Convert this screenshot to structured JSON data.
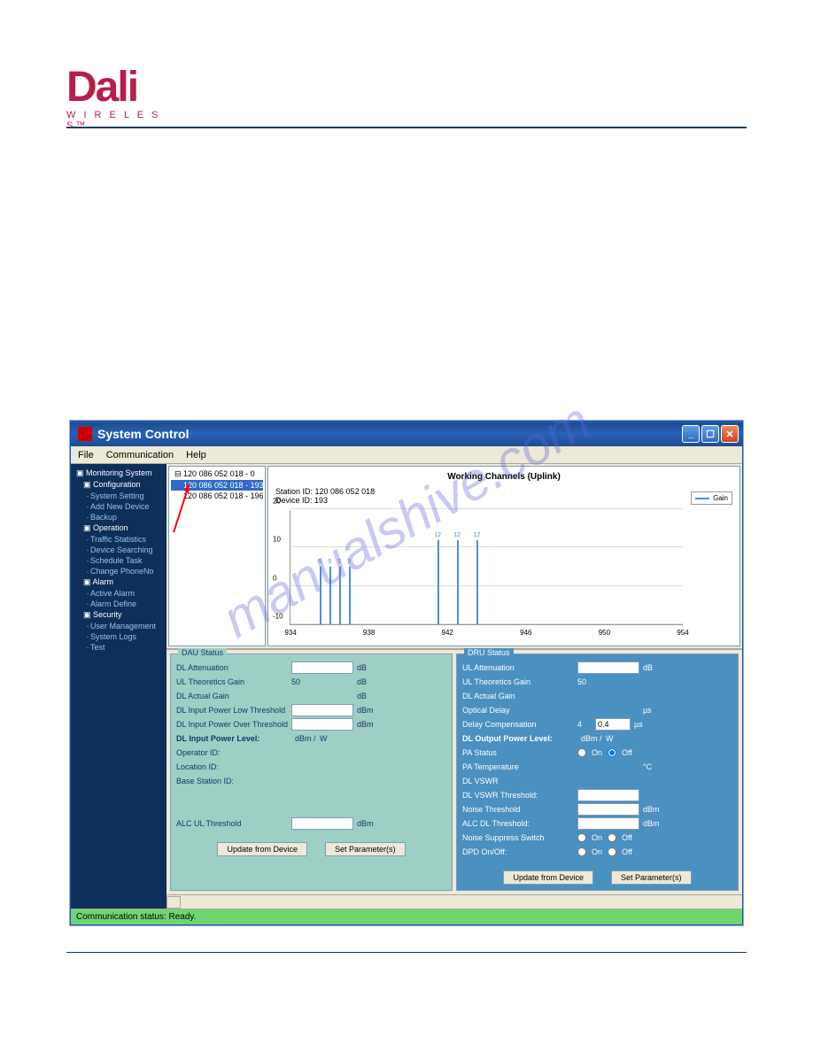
{
  "logo": {
    "brand": "Dali",
    "sub": "W I R E L E S S™"
  },
  "watermark": "manualshive.com",
  "window": {
    "title": "System Control",
    "min_icon": "_",
    "max_icon": "☐",
    "close_icon": "✕"
  },
  "menubar": {
    "file": "File",
    "communication": "Communication",
    "help": "Help"
  },
  "sidebar": {
    "monitoring": "Monitoring System",
    "configuration": "Configuration",
    "system_setting": "System Setting",
    "add_new_device": "Add New Device",
    "backup": "Backup",
    "operation": "Operation",
    "traffic_statistics": "Traffic Statistics",
    "device_searching": "Device Searching",
    "schedule_task": "Schedule Task",
    "change_phoneno": "Change PhoneNo",
    "alarm": "Alarm",
    "active_alarm": "Active Alarm",
    "alarm_define": "Alarm Define",
    "security": "Security",
    "user_management": "User Management",
    "system_logs": "System Logs",
    "test": "Test"
  },
  "device_tree": {
    "items": [
      "120 086 052 018 - 0",
      "120 086 052 018 - 193",
      "120 086 052 018 - 196"
    ]
  },
  "chart": {
    "title": "Working Channels (Uplink)",
    "station_id_label": "Station ID: 120 086 052 018",
    "device_id_label": "Device ID: 193",
    "legend": "Gain"
  },
  "chart_data": {
    "type": "bar",
    "title": "Working Channels (Uplink)",
    "ylabel": "Gain",
    "ylim": [
      -10,
      20
    ],
    "yticks": [
      -10,
      0,
      10,
      20
    ],
    "xticks": [
      934,
      938,
      942,
      946,
      950,
      954
    ],
    "spikes": [
      {
        "x": 935.5,
        "value": 5,
        "label": "5"
      },
      {
        "x": 936.0,
        "value": 5,
        "label": "5"
      },
      {
        "x": 936.5,
        "value": 5,
        "label": "5"
      },
      {
        "x": 937.0,
        "value": 5,
        "label": "5"
      },
      {
        "x": 941.5,
        "value": 12,
        "label": "12"
      },
      {
        "x": 942.5,
        "value": 12,
        "label": "12"
      },
      {
        "x": 943.5,
        "value": 12,
        "label": "12"
      }
    ],
    "station_id": "120 086 052 018",
    "device_id": "193",
    "legend": [
      "Gain"
    ]
  },
  "dau": {
    "title": "DAU Status",
    "dl_attenuation": "DL Attenuation",
    "ul_theoretical_gain": "UL Theoretics Gain",
    "ul_theoretical_gain_val": "50",
    "dl_actual_gain": "DL Actual Gain",
    "dl_input_low": "DL Input Power Low Threshold",
    "dl_input_over": "DL Input Power Over Threshold",
    "dl_input_power": "DL Input Power Level:",
    "dl_input_power_unit1": "dBm /",
    "dl_input_power_unit2": "W",
    "operator_id": "Operator ID:",
    "location_id": "Location ID:",
    "base_station_id": "Base Station ID:",
    "alc_ul": "ALC UL Threshold",
    "db": "dB",
    "dbm": "dBm",
    "update_btn": "Update from Device",
    "set_btn": "Set Parameter(s)"
  },
  "dru": {
    "title": "DRU Status",
    "ul_attenuation": "UL Attenuation",
    "ul_theoretical_gain": "UL Theoretics Gain",
    "ul_theoretical_gain_val": "50",
    "dl_actual_gain": "DL Actual Gain",
    "optical_delay": "Optical Delay",
    "delay_comp": "Delay Compensation",
    "delay_comp_val": "4",
    "delay_comp_input": "0.4",
    "dl_output_power": "DL Output Power Level:",
    "dl_output_power_unit1": "dBm /",
    "dl_output_power_unit2": "W",
    "pa_status": "PA Status",
    "pa_temp": "PA Temperature",
    "dl_vswr": "DL VSWR",
    "dl_vswr_thresh": "DL VSWR Threshold:",
    "noise_thresh": "Noise Threshold",
    "alc_dl_thresh": "ALC DL Threshold:",
    "noise_suppress": "Noise Suppress Switch",
    "dpd": "DPD On/Off:",
    "on": "On",
    "off": "Off",
    "db": "dB",
    "dbm": "dBm",
    "us": "µs",
    "celsius": "°C",
    "update_btn": "Update from Device",
    "set_btn": "Set Parameter(s)"
  },
  "statusbar": "Communication status: Ready."
}
